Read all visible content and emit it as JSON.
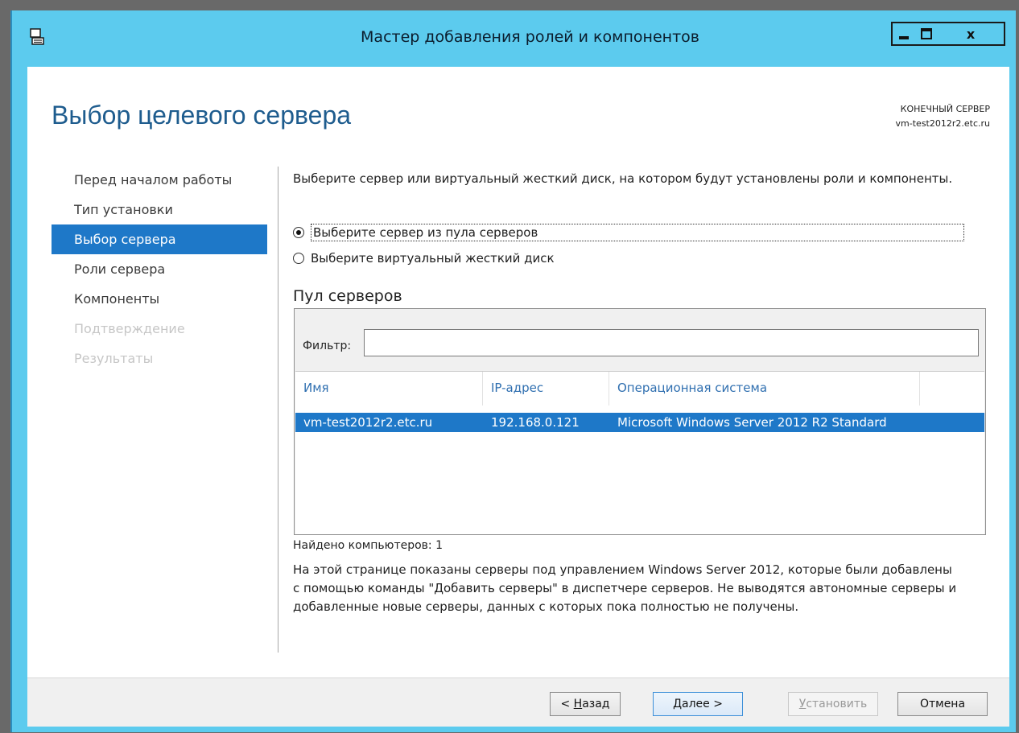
{
  "window": {
    "title": "Мастер добавления ролей и компонентов",
    "controls": {
      "minimize": "–",
      "maximize": "□",
      "close": "x"
    }
  },
  "header": {
    "page_title": "Выбор целевого сервера",
    "destination_label": "КОНЕЧНЫЙ СЕРВЕР",
    "destination_server": "vm-test2012r2.etc.ru"
  },
  "nav": {
    "items": [
      {
        "label": "Перед началом работы",
        "state": "normal"
      },
      {
        "label": "Тип установки",
        "state": "normal"
      },
      {
        "label": "Выбор сервера",
        "state": "selected"
      },
      {
        "label": "Роли сервера",
        "state": "normal"
      },
      {
        "label": "Компоненты",
        "state": "normal"
      },
      {
        "label": "Подтверждение",
        "state": "disabled"
      },
      {
        "label": "Результаты",
        "state": "disabled"
      }
    ]
  },
  "main": {
    "intro": "Выберите сервер или виртуальный жесткий диск, на котором будут установлены роли и компоненты.",
    "radio_pool": "Выберите сервер из пула серверов",
    "radio_vhd": "Выберите виртуальный жесткий диск",
    "selected_option": "pool",
    "pool_title": "Пул серверов",
    "filter_label": "Фильтр:",
    "filter_value": "",
    "table": {
      "columns": [
        "Имя",
        "IP-адрес",
        "Операционная система"
      ],
      "rows": [
        {
          "name": "vm-test2012r2.etc.ru",
          "ip": "192.168.0.121",
          "os": "Microsoft Windows Server 2012 R2 Standard",
          "selected": true
        }
      ]
    },
    "found": "Найдено компьютеров: 1",
    "note": "На этой странице показаны серверы под управлением Windows Server 2012, которые были добавлены с помощью команды \"Добавить серверы\" в диспетчере серверов. Не выводятся автономные серверы и добавленные новые серверы, данных с которых пока полностью не получены."
  },
  "footer": {
    "back_prefix": "< ",
    "back_key": "Н",
    "back_rest": "азад",
    "next_key": "Д",
    "next_rest": "алее >",
    "install_key": "У",
    "install_rest": "становить",
    "cancel": "Отмена"
  },
  "colors": {
    "titlebar": "#5ccbee",
    "accent": "#1e78c8",
    "heading": "#1e5c8e"
  }
}
